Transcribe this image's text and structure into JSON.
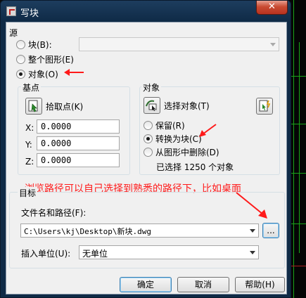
{
  "window": {
    "title": "写块",
    "close_symbol": "✕"
  },
  "source": {
    "title": "源",
    "options": [
      {
        "label": "块(B):",
        "selected": false
      },
      {
        "label": "整个图形(E)",
        "selected": false
      },
      {
        "label": "对象(O)",
        "selected": true
      }
    ],
    "block_combo_value": ""
  },
  "base_point": {
    "title": "基点",
    "pick_label": "拾取点(K)",
    "x_label": "X:",
    "x_value": "0.0000",
    "y_label": "Y:",
    "y_value": "0.0000",
    "z_label": "Z:",
    "z_value": "0.0000"
  },
  "objects": {
    "title": "对象",
    "select_label": "选择对象(T)",
    "options": [
      {
        "label": "保留(R)",
        "selected": false
      },
      {
        "label": "转换为块(C)",
        "selected": true
      },
      {
        "label": "从图形中删除(D)",
        "selected": false
      }
    ],
    "selected_count": "已选择 1250 个对象"
  },
  "annotation": {
    "text": "浏览路径可以自己选择到熟悉的路径下，比如桌面"
  },
  "destination": {
    "title": "目标",
    "path_label": "文件名和路径(F):",
    "path_value": "C:\\Users\\kj\\Desktop\\新块.dwg",
    "browse_label": "...",
    "units_label": "插入单位(U):",
    "units_value": "无单位"
  },
  "buttons": {
    "ok": "确定",
    "cancel": "取消",
    "help": "帮助(H)"
  },
  "colors": {
    "annotation": "#ff1a1a",
    "title_bar": "#0f2a46",
    "dialog_bg": "#f0f0f0"
  }
}
